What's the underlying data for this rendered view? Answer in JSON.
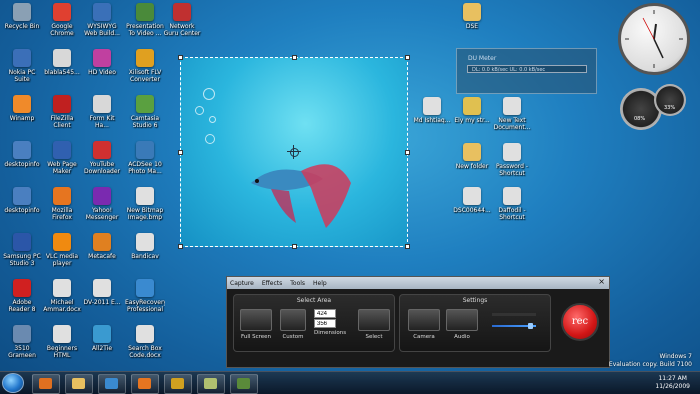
{
  "desktop": {
    "col1": [
      {
        "label": "Recycle Bin",
        "color": "#8aa0b4"
      },
      {
        "label": "Nokia PC Suite",
        "color": "#3b6fb8"
      },
      {
        "label": "Winamp",
        "color": "#f08a2a"
      },
      {
        "label": "desktopinfo",
        "color": "#4a7fc0"
      },
      {
        "label": "desktopinfo",
        "color": "#4a7fc0"
      },
      {
        "label": "Samsung PC Studio 3",
        "color": "#2b56a8"
      },
      {
        "label": "Adobe Reader 8",
        "color": "#d02020"
      },
      {
        "label": "3510 Grameen",
        "color": "#6a8ab0"
      }
    ],
    "col2": [
      {
        "label": "Google Chrome",
        "color": "#e04030"
      },
      {
        "label": "blabla545...",
        "color": "#d8d8d8"
      },
      {
        "label": "FileZilla Client",
        "color": "#c02020"
      },
      {
        "label": "Web Page Maker",
        "color": "#3060b0"
      },
      {
        "label": "Mozilla Firefox",
        "color": "#e67520"
      },
      {
        "label": "VLC media player",
        "color": "#f08a10"
      },
      {
        "label": "Michael Ammar.docx",
        "color": "#e0e0e0"
      },
      {
        "label": "Beginners HTML",
        "color": "#e0e0e0"
      }
    ],
    "col3": [
      {
        "label": "WYSIWYG Web Build...",
        "color": "#3a70b8"
      },
      {
        "label": "HD Video",
        "color": "#c040a0"
      },
      {
        "label": "Form Kit Ha...",
        "color": "#d8d8d8"
      },
      {
        "label": "YouTube Downloader",
        "color": "#d03030"
      },
      {
        "label": "Yahoo! Messenger",
        "color": "#7a2ab0"
      },
      {
        "label": "Metacafe",
        "color": "#e08020"
      },
      {
        "label": "DV-2011 E...",
        "color": "#e0e0e0"
      },
      {
        "label": "All2Tie",
        "color": "#3a9ad0"
      }
    ],
    "col4": [
      {
        "label": "Presentation To Video ...",
        "color": "#4a8a3a"
      },
      {
        "label": "Xilisoft FLV Converter",
        "color": "#e0a020"
      },
      {
        "label": "Camtasia Studio 6",
        "color": "#5aa040"
      },
      {
        "label": "ACDSee 10 Photo Ma...",
        "color": "#3a7ab8"
      },
      {
        "label": "New Bitmap Image.bmp",
        "color": "#e0e0e0"
      },
      {
        "label": "Bandicav",
        "color": "#e0e0e0"
      },
      {
        "label": "EasyRecovery Professional",
        "color": "#3a8ad0"
      },
      {
        "label": "Search Box Code.docx",
        "color": "#e0e0e0"
      }
    ],
    "col5": [
      {
        "label": "Network Guru Center",
        "color": "#c03030"
      }
    ],
    "right_icons": [
      {
        "label": "DSE",
        "color": "#e8c060"
      },
      {
        "label": "Md Ishtiaq...",
        "color": "#e0e0e0"
      },
      {
        "label": "Ely my str...",
        "color": "#e0c050"
      },
      {
        "label": "New Text Document...",
        "color": "#e0e0e0"
      },
      {
        "label": "New folder",
        "color": "#e8c060"
      },
      {
        "label": "Password - Shortcut",
        "color": "#e0e0e0"
      },
      {
        "label": "DSC00644...",
        "color": "#e0e0e0"
      },
      {
        "label": "Daffodil - Shortcut",
        "color": "#e0e0e0"
      }
    ]
  },
  "du_meter": {
    "title": "DU Meter",
    "reading": "DL: 0.0 kB/sec  UL: 0.0 kB/sec"
  },
  "gauges": {
    "cpu": "08%",
    "mem": "33%"
  },
  "capture_window": {
    "menu": [
      "Capture",
      "Effects",
      "Tools",
      "Help"
    ],
    "close": "×",
    "select_area": {
      "title": "Select Area",
      "full_screen": "Full Screen",
      "custom": "Custom",
      "dimensions": "Dimensions",
      "width": "424",
      "height": "356",
      "select": "Select"
    },
    "settings": {
      "title": "Settings",
      "camera": "Camera",
      "audio": "Audio",
      "audio_level": 0.85
    },
    "rec": "rec"
  },
  "watermark": {
    "os": "Windows 7",
    "build": "Evaluation copy. Build 7100"
  },
  "taskbar": {
    "time": "11:27 AM",
    "date": "11/26/2009",
    "items": [
      {
        "name": "media-player-icon",
        "color": "#e07020"
      },
      {
        "name": "explorer-icon",
        "color": "#e8c060"
      },
      {
        "name": "ie-icon",
        "color": "#3a8ad0"
      },
      {
        "name": "firefox-icon",
        "color": "#e67520"
      },
      {
        "name": "tool-icon",
        "color": "#d0a020"
      },
      {
        "name": "folder-icon",
        "color": "#b0c070"
      },
      {
        "name": "camtasia-icon",
        "color": "#5a8a3a"
      }
    ]
  }
}
